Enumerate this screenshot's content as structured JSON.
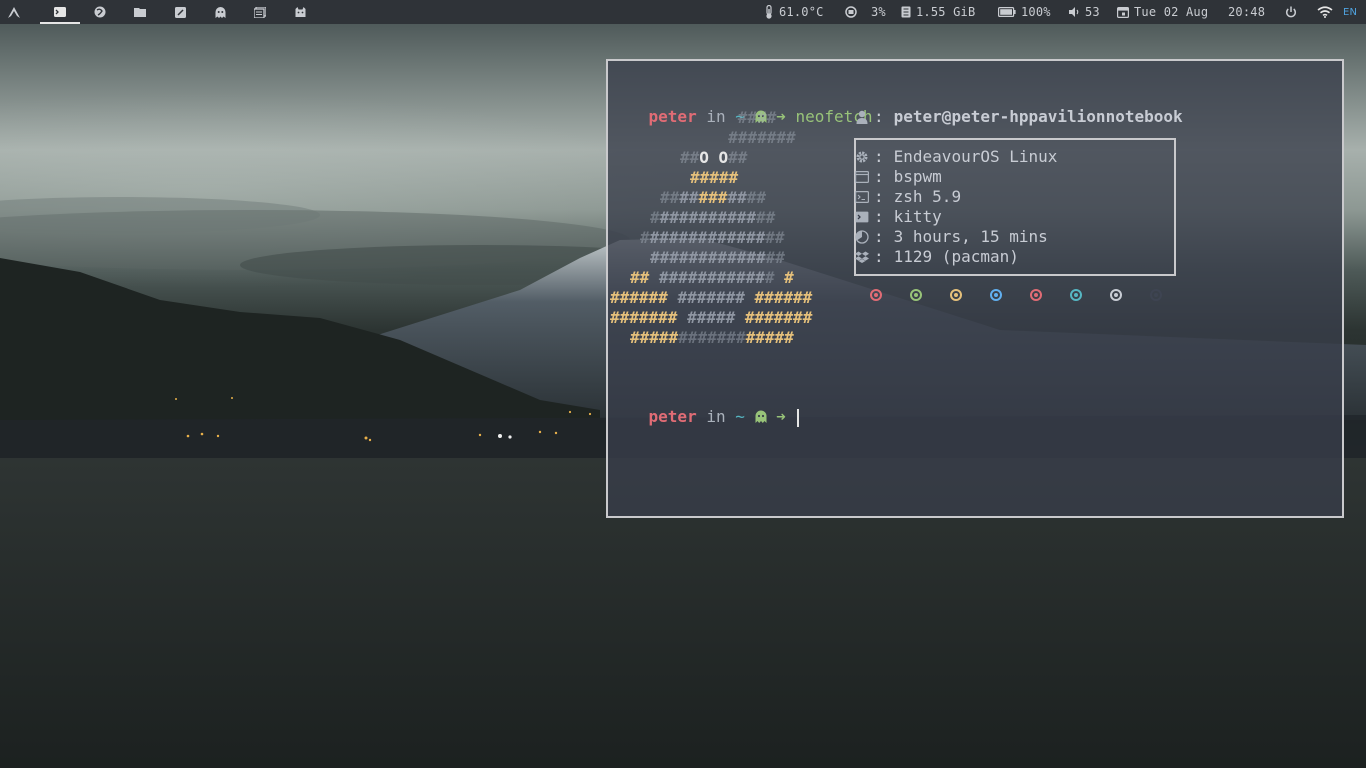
{
  "topbar": {
    "workspaces": [
      {
        "icon": "terminal-icon",
        "active": true
      },
      {
        "icon": "browser-icon",
        "active": false
      },
      {
        "icon": "folder-icon",
        "active": false
      },
      {
        "icon": "editor-icon",
        "active": false
      },
      {
        "icon": "ghost-icon",
        "active": false
      },
      {
        "icon": "files-icon",
        "active": false
      },
      {
        "icon": "cat-icon",
        "active": false
      }
    ],
    "temperature": "61.0°C",
    "cpu": "3%",
    "memory": "1.55 GiB",
    "battery": "100%",
    "volume": "53",
    "date": "Tue 02 Aug",
    "time": "20:48",
    "keyboard_layout": "EN"
  },
  "terminal": {
    "prompt_user": "peter",
    "prompt_in": "in",
    "prompt_dir": "~",
    "prompt_arrow": "➜",
    "command": "neofetch",
    "neofetch": {
      "host": "peter@peter-hppavilionnotebook",
      "os": "EndeavourOS Linux",
      "wm": "bspwm",
      "shell": "zsh 5.9",
      "terminal": "kitty",
      "uptime": "3 hours, 15 mins",
      "packages": "1129 (pacman)"
    },
    "palette": [
      "#e06c75",
      "#98c379",
      "#e5c07b",
      "#61afef",
      "#e06c75",
      "#56b6c2",
      "#c8ccd4",
      "#3e4452"
    ],
    "ascii_art": [
      "      ####",
      "     #######",
      "     ##O O##",
      "     #######",
      "   ###########",
      "  #############",
      " ###############",
      " ###############",
      "## ########### #",
      "###### ####### ######",
      "####### ##### #######",
      "  #####       #####"
    ]
  },
  "colors": {
    "accent": "#e06c75",
    "prompt_green": "#98c379",
    "ascii_yellow": "#e5c07b",
    "topbar_bg": "#2f3338"
  }
}
